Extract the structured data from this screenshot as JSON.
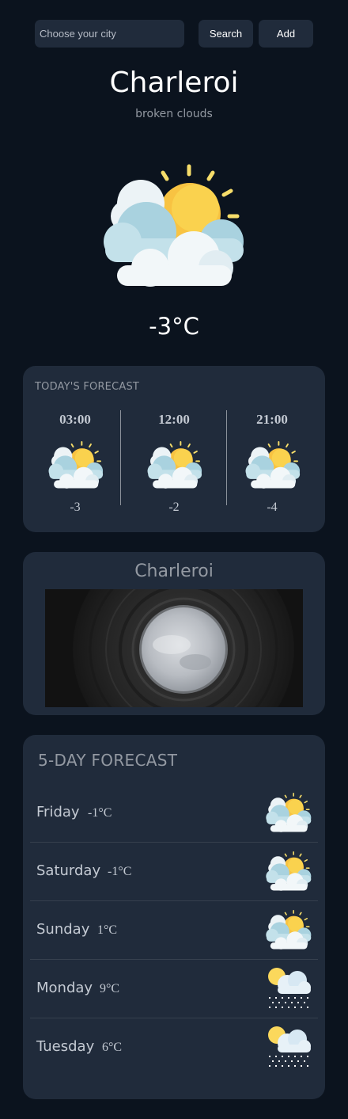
{
  "search": {
    "placeholder": "Choose your city",
    "search_label": "Search",
    "add_label": "Add"
  },
  "current": {
    "city": "Charleroi",
    "condition": "broken clouds",
    "temperature": "-3°C",
    "icon": "sun-behind-clouds-icon"
  },
  "today": {
    "title": "TODAY'S FORECAST",
    "slots": [
      {
        "time": "03:00",
        "temp": "-3",
        "icon": "sun-behind-clouds-icon"
      },
      {
        "time": "12:00",
        "temp": "-2",
        "icon": "sun-behind-clouds-icon"
      },
      {
        "time": "21:00",
        "temp": "-4",
        "icon": "sun-behind-clouds-icon"
      }
    ]
  },
  "photo": {
    "title": "Charleroi",
    "image": "sky-through-cooling-tower-photo"
  },
  "week": {
    "title": "5-DAY FORECAST",
    "days": [
      {
        "day": "Friday",
        "temp": "-1°C",
        "icon": "sun-behind-clouds-icon"
      },
      {
        "day": "Saturday",
        "temp": "-1°C",
        "icon": "sun-behind-clouds-icon"
      },
      {
        "day": "Sunday",
        "temp": "1°C",
        "icon": "sun-behind-clouds-icon"
      },
      {
        "day": "Monday",
        "temp": "9°C",
        "icon": "rain-cloud-icon"
      },
      {
        "day": "Tuesday",
        "temp": "6°C",
        "icon": "rain-cloud-icon"
      }
    ]
  },
  "colors": {
    "background": "#0b131e",
    "card": "#202b3b",
    "muted_text": "#9399a2",
    "sun": "#f8c342",
    "cloud": "#e6f0f4"
  }
}
